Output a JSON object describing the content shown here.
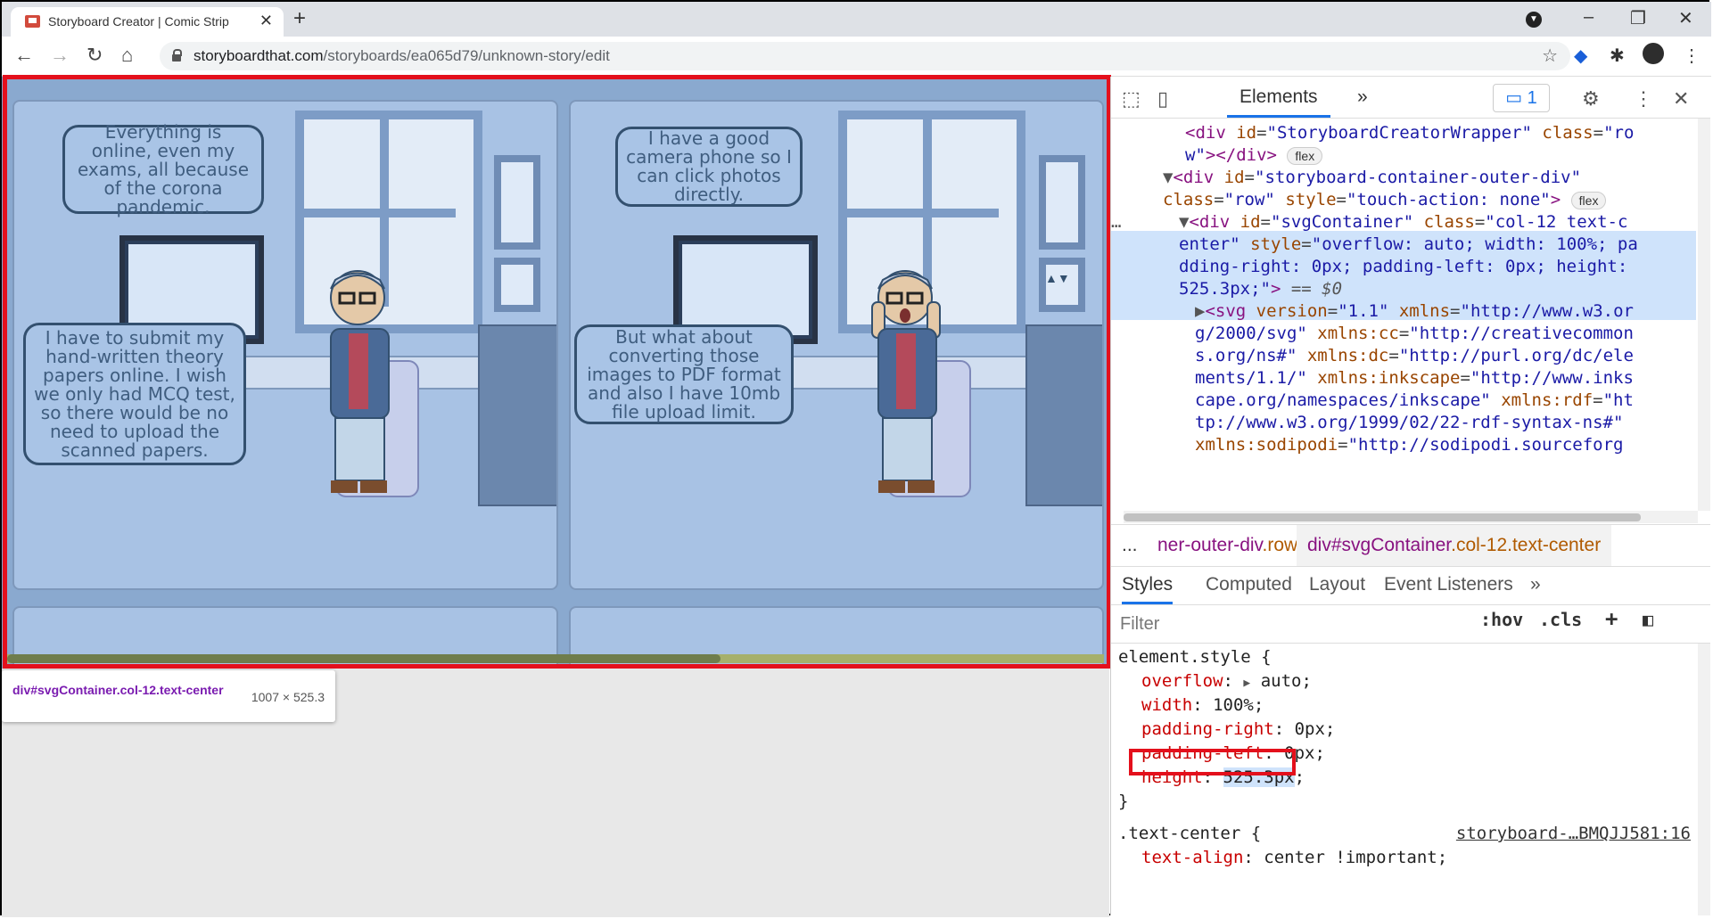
{
  "browser": {
    "tab_title": "Storyboard Creator | Comic Strip",
    "url_host": "storyboardthat.com",
    "url_path": "/storyboards/ea065d79/unknown-story/edit"
  },
  "comic": {
    "panel1": {
      "bubble_top": "Everything is online, even my exams, all because of the corona pandemic.",
      "bubble_bottom": "I have to submit my hand-written theory papers online. I wish we only had MCQ test, so there would be no need to upload the scanned papers."
    },
    "panel2": {
      "bubble_top": "I have a good camera phone so I can click photos directly.",
      "bubble_bottom": "But what about converting those images to PDF format and also I have 10mb file upload limit."
    }
  },
  "inspect_tooltip": {
    "selector_tag": "div",
    "selector_rest": "#svgContainer.col-12.text-center",
    "size": "1007 × 525.3"
  },
  "devtools": {
    "tab_elements": "Elements",
    "more_tabs": "»",
    "issues_count": "1",
    "dom": {
      "line1_attr_val": "\"StoryboardCreatorWrapper\"",
      "line1_class_val": "\"ro",
      "line2": "w\"></div>",
      "pill_flex": "flex",
      "line3_id": "\"storyboard-container-outer-div\"",
      "line4_class": "\"row\"",
      "line4_style": "\"touch-action: none\"",
      "svgcontainer_id": "\"svgContainer\"",
      "svgcontainer_class": "\"col-12 text-c",
      "sel_line2": "enter\"",
      "sel_line2_style": "\"overflow: auto; width: 100%; pa",
      "sel_line3": "dding-right: 0px; padding-left: 0px; height:",
      "sel_line4": "525.3px;\"",
      "sel_eq": "== $0",
      "svg_line1": "\"1.1\"",
      "svg_line1_xmlns": "\"http://www.w3.or",
      "svg_line2": "g/2000/svg\"",
      "svg_line2_cc": "\"http://creativecommon",
      "svg_line3": "s.org/ns#\"",
      "svg_line3_dc": "\"http://purl.org/dc/ele",
      "svg_line4": "ments/1.1/\"",
      "svg_line4_ink": "\"http://www.inks",
      "svg_line5": "cape.org/namespaces/inkscape\"",
      "svg_line5_rdf": "\"ht",
      "svg_line6": "tp://www.w3.org/1999/02/22-rdf-syntax-ns#\"",
      "svg_line7_sodi": "\"http://sodipodi.sourceforg"
    },
    "breadcrumbs": {
      "ellipsis": "...",
      "crumb1_tag": "ner-outer-div",
      "crumb1_class": ".row",
      "crumb2_tag": "div#svgContainer",
      "crumb2_class": ".col-12.text-center"
    },
    "styles_tabs": [
      "Styles",
      "Computed",
      "Layout",
      "Event Listeners"
    ],
    "filter_placeholder": "Filter",
    "hov": ":hov",
    "cls": ".cls",
    "styles": {
      "rule1_selector": "element.style {",
      "props": [
        {
          "name": "overflow",
          "value": "auto;"
        },
        {
          "name": "width",
          "value": "100%;"
        },
        {
          "name": "padding-right",
          "value": "0px;"
        },
        {
          "name": "padding-left",
          "value": "0px;"
        },
        {
          "name": "height",
          "value": "525.3px"
        }
      ],
      "close": "}",
      "rule2_selector": ".text-center {",
      "rule2_source": "storyboard-…BMQJJ581:16",
      "rule2_prop": "text-align",
      "rule2_value": "center !important;"
    }
  }
}
